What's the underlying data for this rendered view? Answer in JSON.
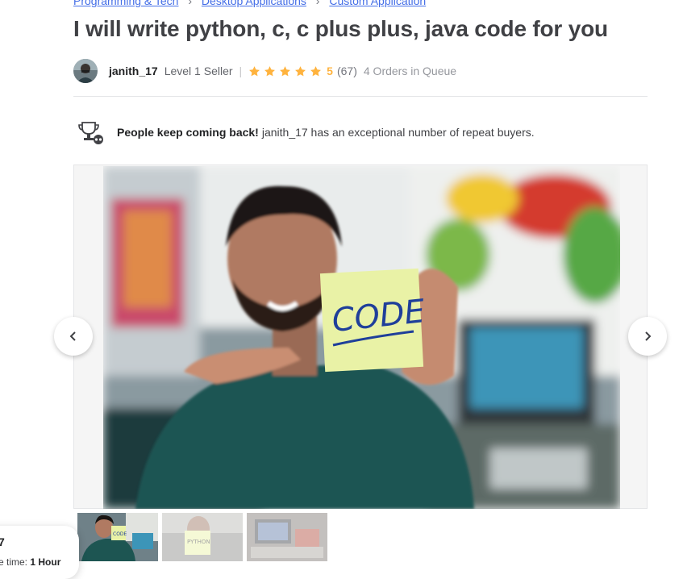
{
  "breadcrumb": {
    "items": [
      "Programming & Tech",
      "Desktop Applications",
      "Custom Application"
    ],
    "separator": "›"
  },
  "gig": {
    "title": "I will write python, c, c plus plus, java code for you"
  },
  "seller": {
    "name": "janith_17",
    "level": "Level 1 Seller",
    "rating": "5",
    "reviews": "(67)",
    "queue": "4 Orders in Queue",
    "stars": 5
  },
  "repeat_buyers": {
    "bold": "People keep coming back!",
    "text": "janith_17 has an exceptional number of repeat buyers."
  },
  "gallery": {
    "main_image": "man-pointing-at-code-sticky-note",
    "sticky_note_text": "CODE",
    "thumbnails": [
      {
        "label": "CODE",
        "active": true
      },
      {
        "label": "PYTHON",
        "active": false
      },
      {
        "label": "",
        "active": false
      }
    ]
  },
  "toast": {
    "line1": "7",
    "line2_prefix": "e time:",
    "line2_value": "1 Hour"
  },
  "colors": {
    "star": "#ffb33e",
    "link": "#446ee7",
    "text": "#404145"
  }
}
